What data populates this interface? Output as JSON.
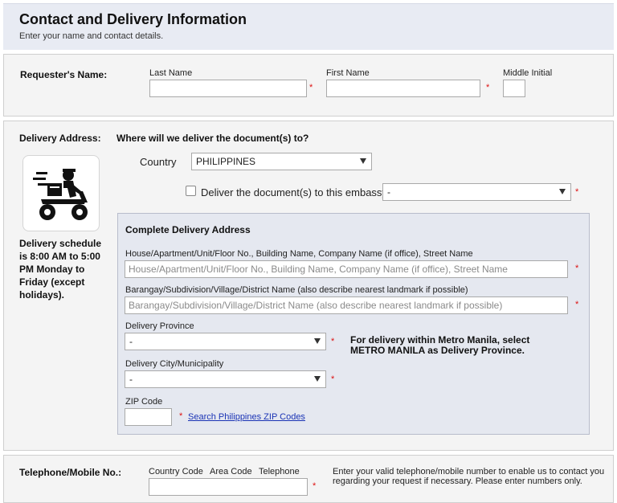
{
  "header": {
    "title": "Contact and Delivery Information",
    "subtitle": "Enter your name and contact details."
  },
  "requester": {
    "label": "Requester's Name:",
    "last_name_label": "Last Name",
    "first_name_label": "First Name",
    "middle_initial_label": "Middle Initial",
    "last_name_value": "",
    "first_name_value": "",
    "middle_initial_value": "",
    "required_mark": "*"
  },
  "delivery": {
    "label": "Delivery Address:",
    "question": "Where will we deliver the document(s) to?",
    "country_label": "Country",
    "country_value": "PHILIPPINES",
    "embassy_checkbox_label": "Deliver the document(s) to this embassy",
    "embassy_checked": false,
    "embassy_value": "-",
    "schedule_text": "Delivery schedule is 8:00 AM to 5:00 PM Monday to Friday (except holidays).",
    "icon": "delivery-motorbike-icon"
  },
  "complete_address": {
    "title": "Complete Delivery Address",
    "street_label": "House/Apartment/Unit/Floor No., Building Name, Company Name (if office), Street Name",
    "street_placeholder": "House/Apartment/Unit/Floor No., Building Name, Company Name (if office), Street Name",
    "barangay_label": "Barangay/Subdivision/Village/District Name (also describe nearest landmark if possible)",
    "barangay_placeholder": "Barangay/Subdivision/Village/District Name (also describe nearest landmark if possible)",
    "province_label": "Delivery Province",
    "province_value": "-",
    "province_note": "For delivery within Metro Manila, select METRO MANILA as Delivery Province.",
    "city_label": "Delivery City/Municipality",
    "city_value": "-",
    "zip_label": "ZIP Code",
    "zip_value": "",
    "zip_link": "Search Philippines ZIP Codes"
  },
  "telephone": {
    "label": "Telephone/Mobile No.:",
    "country_code_label": "Country Code",
    "area_code_label": "Area Code",
    "telephone_label": "Telephone",
    "value": "",
    "note": "Enter your valid telephone/mobile number to enable us to contact you regarding your request if necessary. Please enter numbers only."
  },
  "colors": {
    "header_bg": "#e8ebf3",
    "panel_bg": "#f4f4f4",
    "inner_box_bg": "#e5e8f0",
    "required": "#dd1111",
    "link": "#1a33b5"
  }
}
